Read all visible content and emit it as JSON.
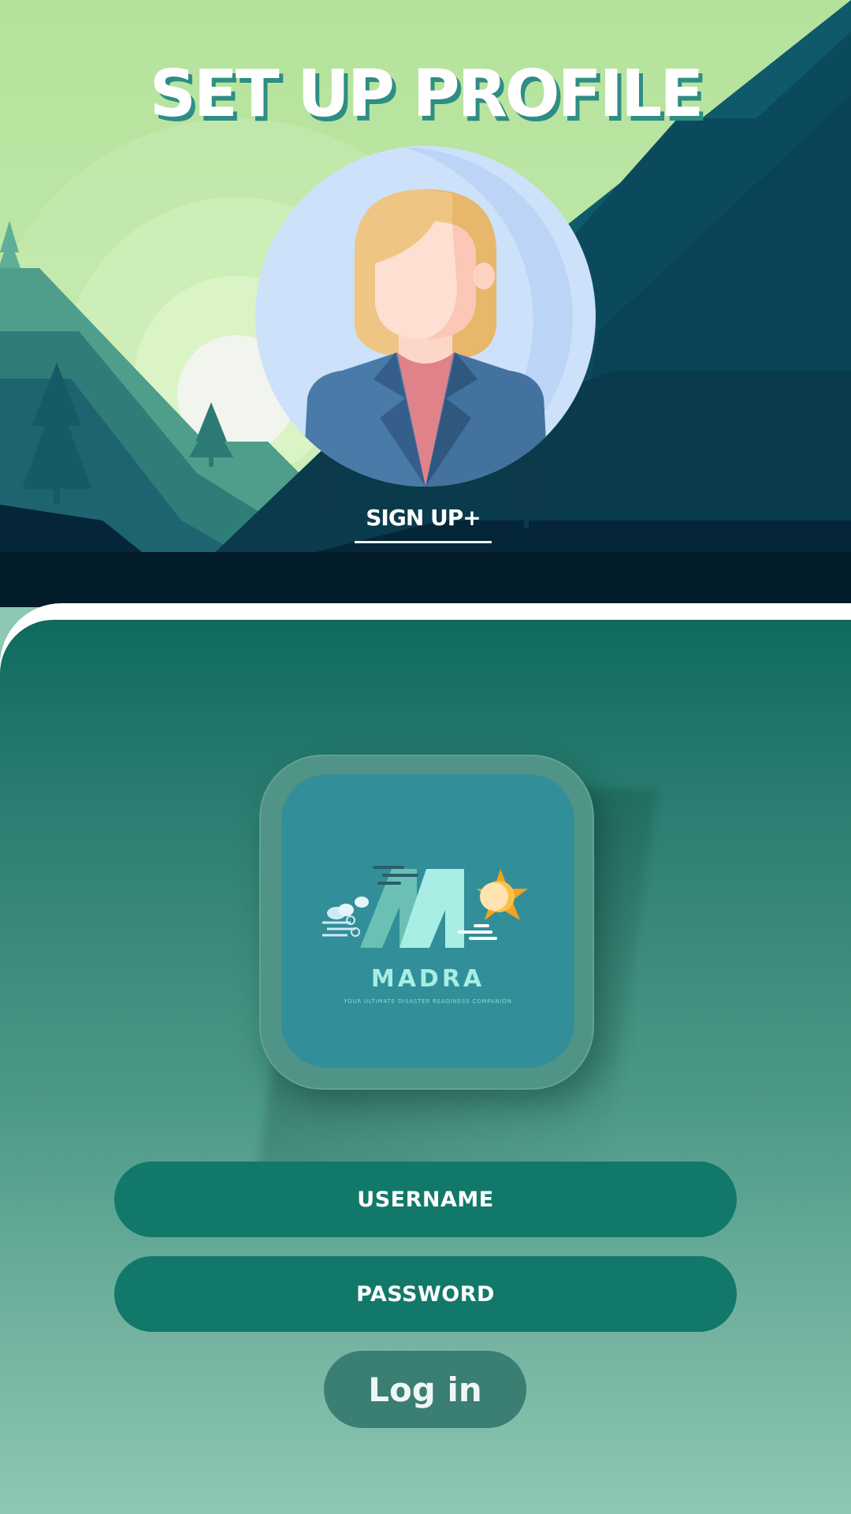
{
  "header": {
    "title": "SET UP PROFILE",
    "signup_link": "SIGN UP+"
  },
  "avatar": {
    "icon": "woman-avatar-icon"
  },
  "logo": {
    "brand": "MADRA",
    "tagline": "YOUR ULTIMATE DISASTER READINESS COMPANION",
    "icon": "madra-logo-icon"
  },
  "form": {
    "username_label": "USERNAME",
    "password_label": "PASSWORD",
    "login_label": "Log in"
  },
  "colors": {
    "accent": "#12796a",
    "panel_top": "#0f6a5e",
    "panel_bottom": "#8dc8b3",
    "sky": "#b6e29f"
  }
}
